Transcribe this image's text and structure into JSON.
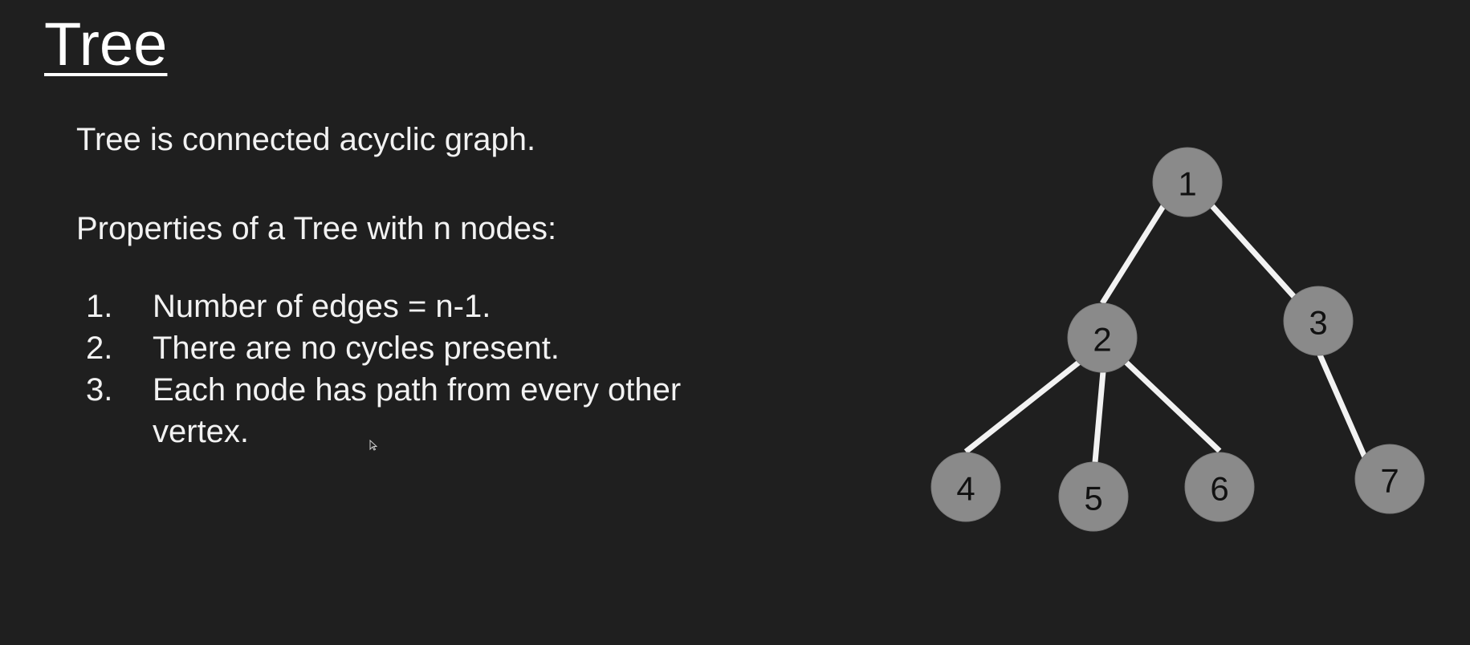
{
  "slide": {
    "title": "Tree",
    "definition": "Tree is connected acyclic graph.",
    "properties_heading": "Properties of a Tree with n nodes:",
    "properties": [
      {
        "number": "1.",
        "text": "Number of edges = n-1."
      },
      {
        "number": "2.",
        "text": "There are no cycles present."
      },
      {
        "number": "3.",
        "text": "Each node has path from every other vertex."
      }
    ]
  },
  "tree": {
    "node_fill": "#8a8a8a",
    "edge_color": "#f2f2f2",
    "background": "#1f1f1f",
    "nodes": [
      {
        "id": "1",
        "label": "1"
      },
      {
        "id": "2",
        "label": "2"
      },
      {
        "id": "3",
        "label": "3"
      },
      {
        "id": "4",
        "label": "4"
      },
      {
        "id": "5",
        "label": "5"
      },
      {
        "id": "6",
        "label": "6"
      },
      {
        "id": "7",
        "label": "7"
      }
    ],
    "edges": [
      {
        "from": "1",
        "to": "2"
      },
      {
        "from": "1",
        "to": "3"
      },
      {
        "from": "2",
        "to": "4"
      },
      {
        "from": "2",
        "to": "5"
      },
      {
        "from": "2",
        "to": "6"
      },
      {
        "from": "3",
        "to": "7"
      }
    ]
  }
}
